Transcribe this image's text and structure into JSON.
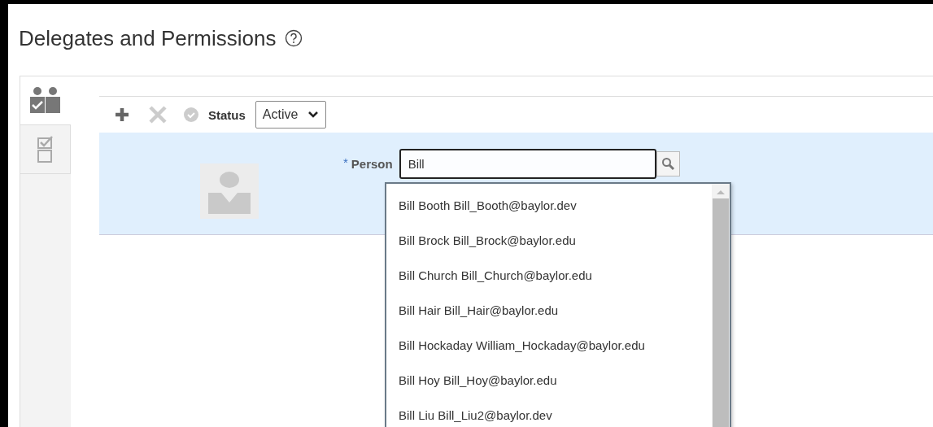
{
  "page": {
    "title": "Delegates and Permissions"
  },
  "side_tabs": [
    {
      "kind": "people",
      "selected": true
    },
    {
      "kind": "checklist",
      "selected": false
    }
  ],
  "toolbar": {
    "status_label": "Status",
    "status_value": "Active",
    "add_disabled": false,
    "delete_disabled": true,
    "confirm_disabled": true
  },
  "form": {
    "person_label": "Person",
    "required_mark": "*",
    "person_value": "Bill"
  },
  "suggestions": [
    {
      "text": "Bill Booth Bill_Booth@baylor.dev"
    },
    {
      "text": "Bill Brock Bill_Brock@baylor.edu"
    },
    {
      "text": "Bill Church Bill_Church@baylor.edu"
    },
    {
      "text": "Bill Hair Bill_Hair@baylor.edu"
    },
    {
      "text": "Bill Hockaday William_Hockaday@baylor.edu"
    },
    {
      "text": "Bill Hoy Bill_Hoy@baylor.edu"
    },
    {
      "text": "Bill Liu Bill_Liu2@baylor.dev"
    }
  ]
}
